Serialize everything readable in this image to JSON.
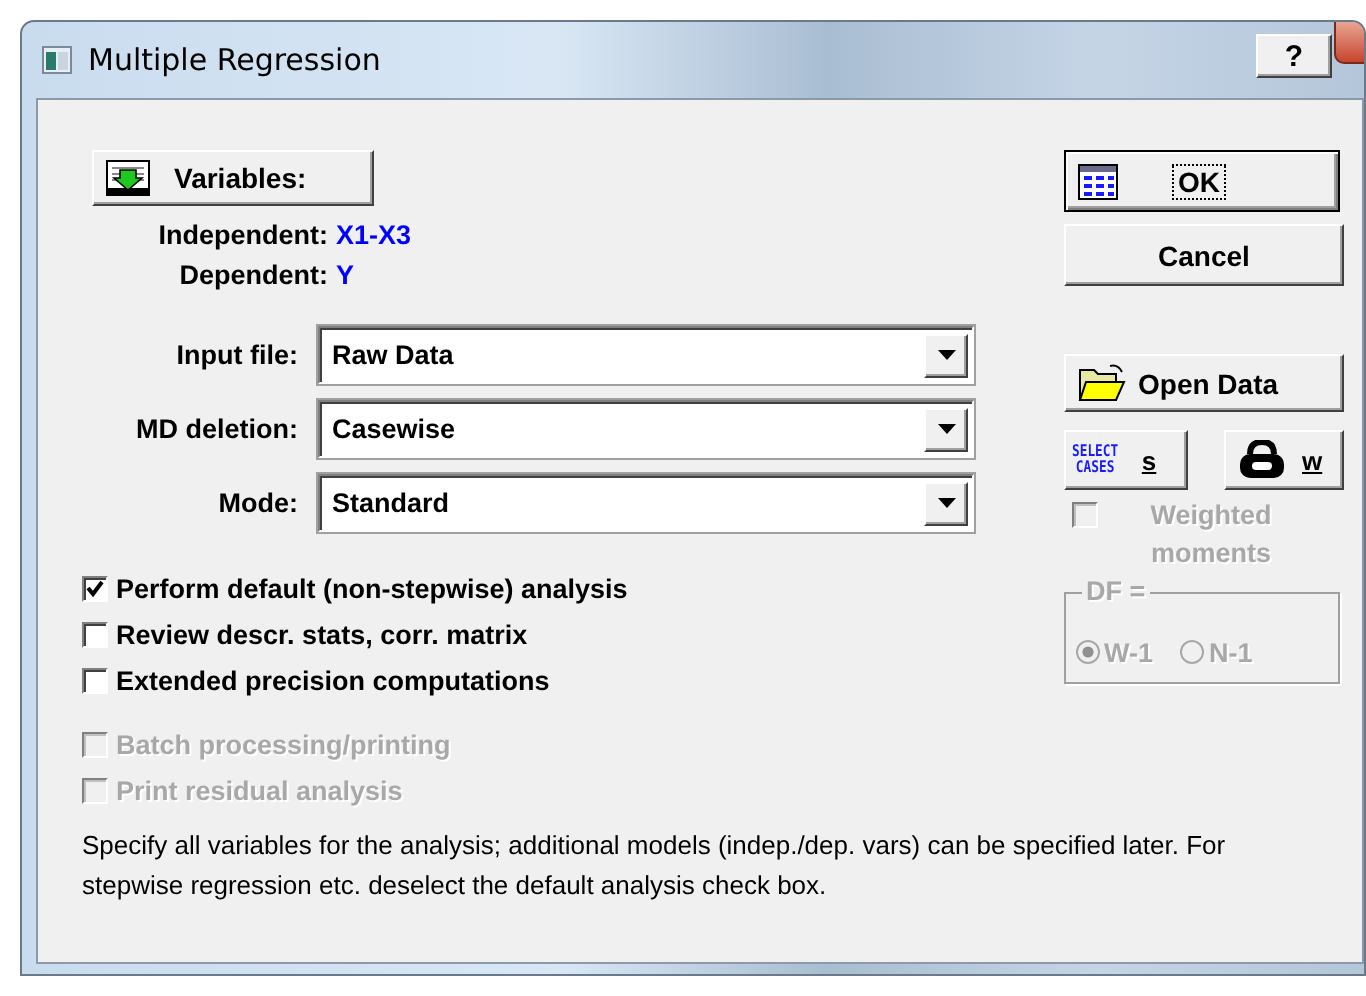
{
  "window": {
    "title": "Multiple Regression",
    "help_button": "?"
  },
  "variables_button": "Variables:",
  "variables": [
    {
      "label": "Independent:",
      "value": "X1-X3"
    },
    {
      "label": "Dependent:",
      "value": "Y"
    }
  ],
  "fields": [
    {
      "label": "Input file:",
      "value": "Raw Data"
    },
    {
      "label": "MD deletion:",
      "value": "Casewise"
    },
    {
      "label": "Mode:",
      "value": "Standard"
    }
  ],
  "options": [
    {
      "label": "Perform default (non-stepwise) analysis",
      "checked": true,
      "disabled": false
    },
    {
      "label": "Review descr. stats, corr. matrix",
      "checked": false,
      "disabled": false
    },
    {
      "label": "Extended precision computations",
      "checked": false,
      "disabled": false
    },
    {
      "label": "Batch processing/printing",
      "checked": false,
      "disabled": true
    },
    {
      "label": "Print residual analysis",
      "checked": false,
      "disabled": true
    }
  ],
  "note": "Specify all variables for the analysis; additional models (indep./dep. vars) can be specified later.  For stepwise regression etc. deselect the default analysis check box.",
  "ok_button": "OK",
  "cancel_button": "Cancel",
  "open_data_button": "Open Data",
  "select_cases_button": {
    "icon_text": [
      "SELECT",
      "CASES"
    ],
    "label": "s"
  },
  "weight_button": "w",
  "weighted": {
    "label": "Weighted moments",
    "checked": false,
    "disabled": true
  },
  "df": {
    "legend": "DF =",
    "disabled": true,
    "options": [
      {
        "label": "W-1",
        "selected": true
      },
      {
        "label": "N-1",
        "selected": false
      }
    ]
  }
}
